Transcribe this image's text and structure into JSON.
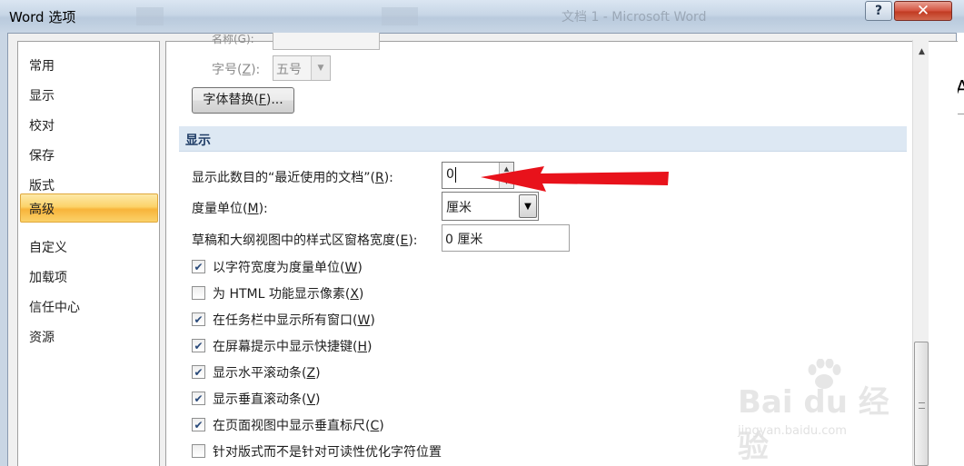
{
  "window": {
    "title": "Word 选项",
    "background_app_title": "文档 1 - Microsoft Word",
    "help_label": "?",
    "close_label": "✕"
  },
  "nav": {
    "items": [
      {
        "label": "常用"
      },
      {
        "label": "显示"
      },
      {
        "label": "校对"
      },
      {
        "label": "保存"
      },
      {
        "label": "版式"
      },
      {
        "label": "高级",
        "selected": true
      },
      {
        "label": "自定义"
      },
      {
        "label": "加载项"
      },
      {
        "label": "信任中心"
      },
      {
        "label": "资源"
      }
    ]
  },
  "font_section": {
    "partial_label": "名称(G):",
    "size_label_pre": "字号(",
    "size_label_key": "Z",
    "size_label_post": "):",
    "size_value": "五号",
    "font_sub_button_pre": "字体替换(",
    "font_sub_button_key": "F",
    "font_sub_button_post": ")..."
  },
  "display_section": {
    "header": "显示",
    "recent_docs_label_pre": "显示此数目的“最近使用的文档”(",
    "recent_docs_label_key": "R",
    "recent_docs_label_post": "):",
    "recent_docs_value": "0",
    "units_label_pre": "度量单位(",
    "units_label_key": "M",
    "units_label_post": "):",
    "units_value": "厘米",
    "style_area_label_pre": "草稿和大纲视图中的样式区窗格宽度(",
    "style_area_label_key": "E",
    "style_area_label_post": "):",
    "style_area_value": "0 厘米"
  },
  "checkboxes": [
    {
      "pre": "以字符宽度为度量单位(",
      "key": "W",
      "post": ")",
      "checked": true
    },
    {
      "pre": "为 HTML 功能显示像素(",
      "key": "X",
      "post": ")",
      "checked": false
    },
    {
      "pre": "在任务栏中显示所有窗口(",
      "key": "W",
      "post": ")",
      "checked": true
    },
    {
      "pre": "在屏幕提示中显示快捷键(",
      "key": "H",
      "post": ")",
      "checked": true
    },
    {
      "pre": "显示水平滚动条(",
      "key": "Z",
      "post": ")",
      "checked": true
    },
    {
      "pre": "显示垂直滚动条(",
      "key": "V",
      "post": ")",
      "checked": true
    },
    {
      "pre": "在页面视图中显示垂直标尺(",
      "key": "C",
      "post": ")",
      "checked": true
    },
    {
      "pre": "针对版式而不是针对可读性优化字符位置",
      "key": "",
      "post": "",
      "checked": false
    }
  ],
  "annotation": {
    "arrow_color": "#e8121b"
  },
  "watermark": {
    "logo": "Bai du 经验",
    "url": "jingyan.baidu.com"
  },
  "background_right_text": "A",
  "colors": {
    "selected_nav": "#f8b43a",
    "section_header": "#dde8f3",
    "section_text": "#1f3c66"
  }
}
